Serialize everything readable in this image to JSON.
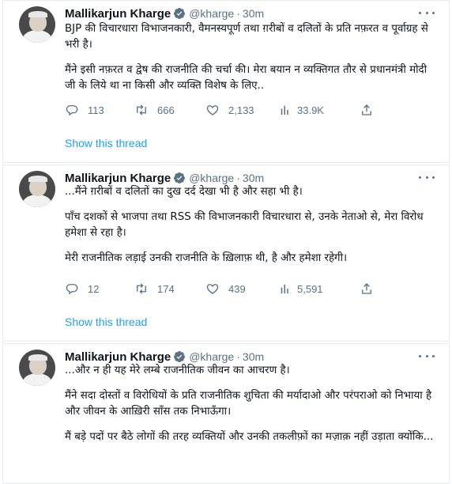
{
  "accent_color": "#1da1f2",
  "tweets": [
    {
      "name": "Mallikarjun Kharge",
      "handle": "@kharge",
      "time": "30m",
      "paragraphs": [
        "BJP की विचारधारा विभाजनकारी, वैमनस्यपूर्ण तथा ग़रीबों व दलितों के प्रति नफ़रत व पूर्वाग्रह से भरी है।",
        "मैंने इसी नफ़रत व द्वेष की राजनीति की चर्चा की। मेरा बयान न व्यक्तिगत तौर से प्रधानमंत्री मोदी जी के लिये था ना किसी और व्यक्ति विशेष के लिए.."
      ],
      "replies": "113",
      "retweets": "666",
      "likes": "2,133",
      "views": "33.9K",
      "show_thread": "Show this thread"
    },
    {
      "name": "Mallikarjun Kharge",
      "handle": "@kharge",
      "time": "30m",
      "paragraphs": [
        "...मैंने ग़रीबों व दलितों का दुख दर्द देखा भी है और सहा भी है।",
        "पाँच दशकों से भाजपा तथा RSS की विभाजनकारी विचारधारा से, उनके नेताओ से, मेरा विरोध हमेशा से रहा है।",
        "मेरी राजनीतिक लड़ाई उनकी राजनीति के ख़िलाफ़ थी, है और हमेशा रहेगी।"
      ],
      "replies": "12",
      "retweets": "174",
      "likes": "439",
      "views": "5,591",
      "show_thread": "Show this thread"
    },
    {
      "name": "Mallikarjun Kharge",
      "handle": "@kharge",
      "time": "30m",
      "paragraphs": [
        "...और न ही यह मेरे लम्बे राजनीतिक जीवन का आचरण है।",
        "मैंने सदा दोस्तों व विरोधियों के प्रति राजनीतिक शुचिता की मर्यादाओ और परंपराओ को निभाया है और जीवन के आख़िरी साँस तक निभाऊँगा।",
        "मैं बड़े पदों पर बैठे लोगों की तरह व्यक्तियों और उनकी तकलीफ़ों का मज़ाक़ नहीं उड़ाता क्योंकि..."
      ]
    }
  ]
}
